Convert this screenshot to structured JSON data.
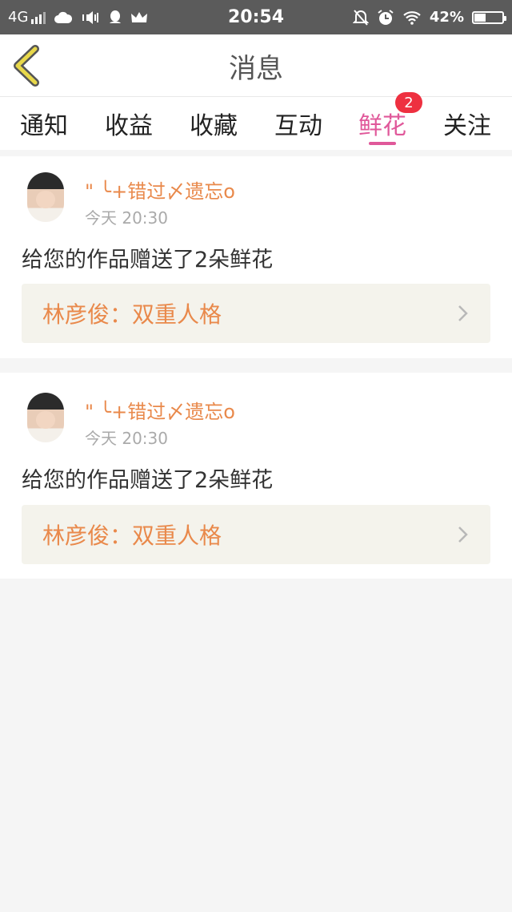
{
  "status_bar": {
    "network": "4G",
    "time": "20:54",
    "battery": "42%",
    "battery_level": 0.42,
    "icons": [
      "signal-icon",
      "cloud-icon",
      "speaker-vibrate-icon",
      "qq-icon",
      "crown-icon",
      "silent-bell-icon",
      "alarm-icon",
      "wifi-icon",
      "battery-icon"
    ]
  },
  "header": {
    "title": "消息",
    "back_icon": "chevron-left-icon"
  },
  "tabs": [
    {
      "label": "通知"
    },
    {
      "label": "收益"
    },
    {
      "label": "收藏"
    },
    {
      "label": "互动"
    },
    {
      "label": "鲜花",
      "active": true,
      "badge": "2"
    },
    {
      "label": "关注"
    }
  ],
  "messages": [
    {
      "username": "\" ╰+错过〆遗忘o",
      "time": "今天 20:30",
      "text": "给您的作品赠送了2朵鲜花",
      "work_title": "林彦俊：双重人格"
    },
    {
      "username": "\" ╰+错过〆遗忘o",
      "time": "今天 20:30",
      "text": "给您的作品赠送了2朵鲜花",
      "work_title": "林彦俊：双重人格"
    }
  ],
  "colors": {
    "accent": "#e0589a",
    "username": "#e9894b",
    "badge": "#ee3040",
    "back_icon": "#e8d84a",
    "background": "#f5f5f5"
  }
}
